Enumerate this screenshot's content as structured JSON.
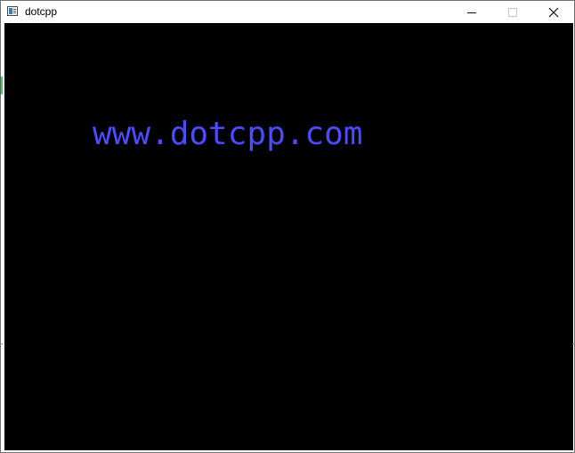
{
  "window": {
    "title": "dotcpp",
    "icon": "console-app-icon",
    "controls": {
      "minimize_icon": "minimize-icon",
      "maximize_icon": "maximize-icon",
      "close_icon": "close-icon"
    }
  },
  "canvas": {
    "background_color": "#000000",
    "text": "www.dotcpp.com",
    "text_color": "#4b4bff"
  }
}
